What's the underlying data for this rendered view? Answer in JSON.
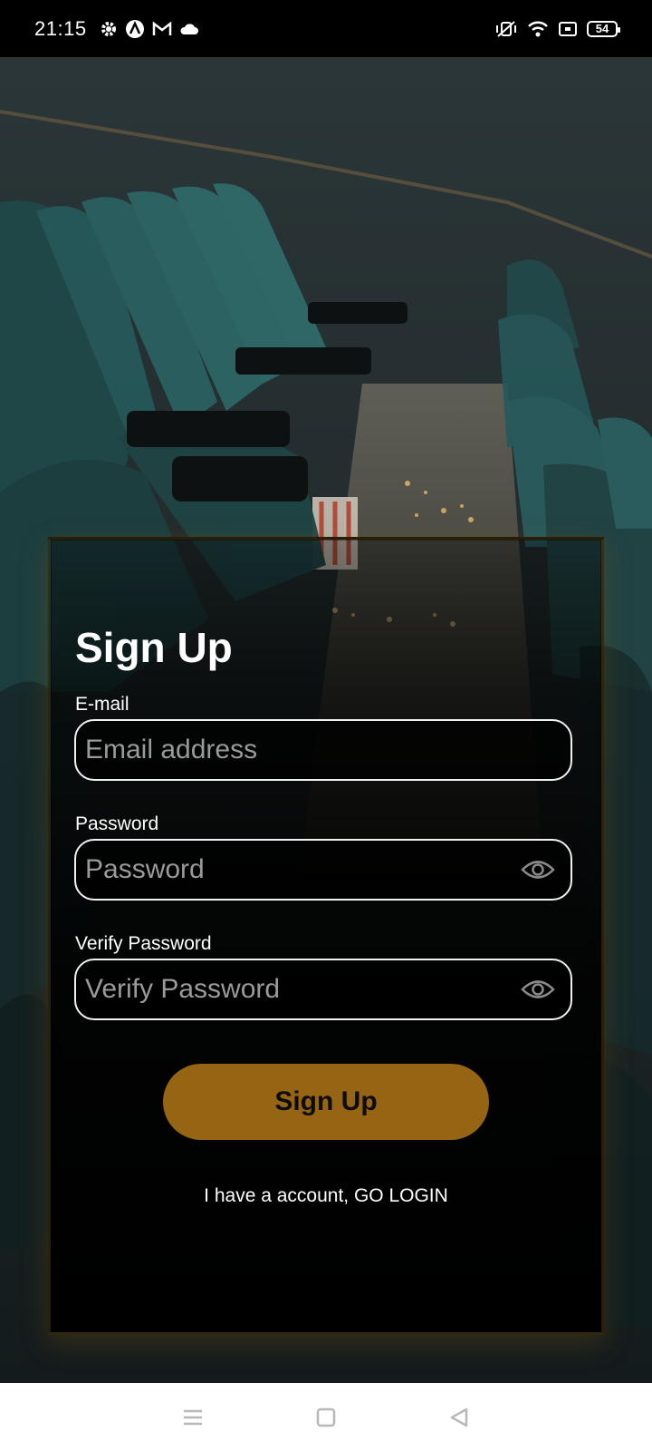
{
  "status_bar": {
    "time": "21:15",
    "left_icons": [
      "gear-icon",
      "a-badge-icon",
      "gmail-icon",
      "cloud-icon"
    ],
    "right_icons": [
      "vibrate-off-icon",
      "wifi-icon",
      "screen-cast-icon",
      "battery-icon"
    ],
    "battery_level": "54"
  },
  "form": {
    "title": "Sign Up",
    "email": {
      "label": "E-mail",
      "placeholder": "Email address",
      "value": ""
    },
    "password": {
      "label": "Password",
      "placeholder": "Password",
      "value": ""
    },
    "verify_password": {
      "label": "Verify Password",
      "placeholder": "Verify Password",
      "value": ""
    },
    "submit_label": "Sign Up",
    "login_link": "I have a account, GO LOGIN"
  },
  "colors": {
    "accent": "#966513",
    "background": "#000000",
    "field_border": "#f2f2f2",
    "placeholder": "#9a9a9a"
  },
  "nav_bar": {
    "buttons": [
      "menu-icon",
      "home-icon",
      "back-icon"
    ]
  }
}
